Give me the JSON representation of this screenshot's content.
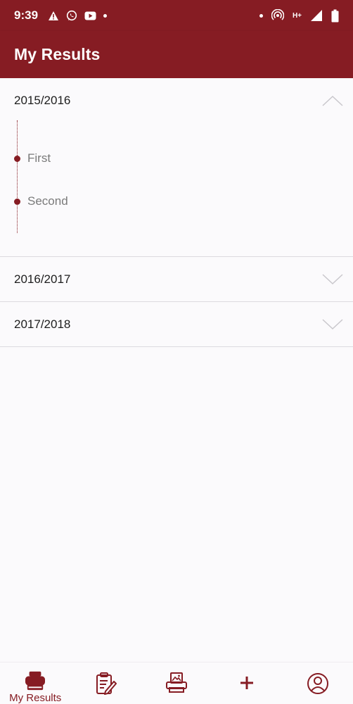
{
  "status_bar": {
    "time": "9:39",
    "left_icons": [
      "warning-icon",
      "whatsapp-icon",
      "youtube-icon",
      "notification-dot-icon"
    ],
    "network_label_top": "H+",
    "right_icons": [
      "dot-icon",
      "hotspot-icon",
      "network-icon",
      "signal-icon",
      "battery-icon"
    ]
  },
  "app_bar": {
    "title": "My Results"
  },
  "years": [
    {
      "label": "2015/2016",
      "expanded": true,
      "terms": [
        "First",
        "Second"
      ]
    },
    {
      "label": "2016/2017",
      "expanded": false
    },
    {
      "label": "2017/2018",
      "expanded": false
    }
  ],
  "bottom_nav": {
    "items": [
      {
        "name": "my-results",
        "label": "My Results",
        "icon": "printer-results-icon",
        "active": true
      },
      {
        "name": "registration",
        "label": "",
        "icon": "clipboard-edit-icon",
        "active": false
      },
      {
        "name": "fees",
        "label": "",
        "icon": "printer-image-icon",
        "active": false
      },
      {
        "name": "add",
        "label": "",
        "icon": "plus-icon",
        "active": false
      },
      {
        "name": "profile",
        "label": "",
        "icon": "user-circle-icon",
        "active": false
      }
    ]
  },
  "colors": {
    "brand": "#861c23",
    "background": "#fbfafc",
    "divider": "#dcdadf"
  }
}
